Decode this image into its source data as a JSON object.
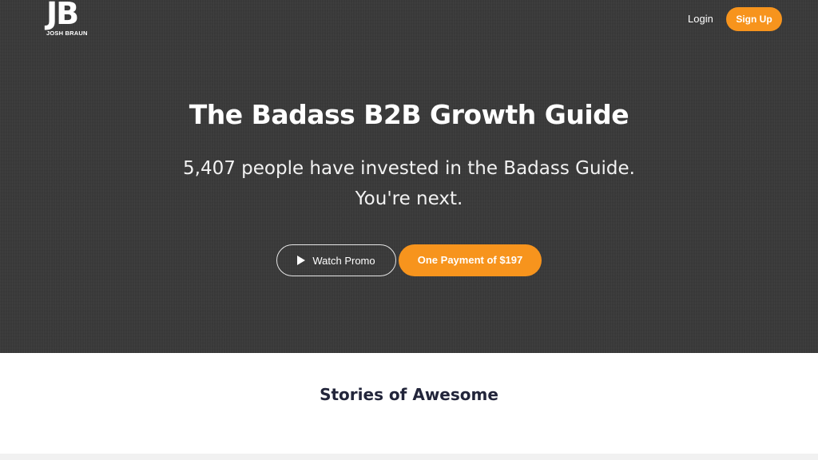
{
  "header": {
    "logo_mark": "JB",
    "logo_text": "JOSH BRAUN",
    "login_label": "Login",
    "signup_label": "Sign Up"
  },
  "hero": {
    "title": "The Badass B2B Growth Guide",
    "subtitle_line1": "5,407 people have invested in the Badass Guide.",
    "subtitle_line2": "You're next.",
    "watch_label": "Watch Promo",
    "buy_label": "One Payment of $197"
  },
  "stories": {
    "title": "Stories of Awesome"
  },
  "colors": {
    "accent": "#f7941d",
    "hero_bg": "#3a3a3a",
    "heading_dark": "#22253a"
  },
  "icons": {
    "watch": "play-icon"
  }
}
